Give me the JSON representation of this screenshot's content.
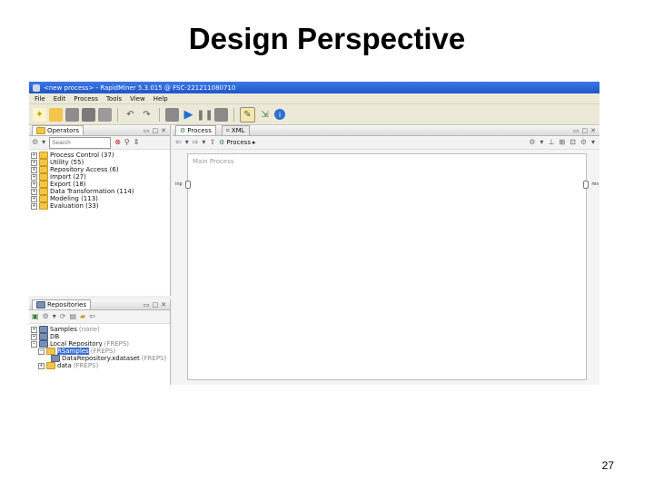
{
  "slide": {
    "title": "Design Perspective",
    "page_number": "27"
  },
  "window": {
    "title": "<new process> - RapidMiner 5.3.015 @ FSC-221211080710"
  },
  "menu": {
    "items": [
      "File",
      "Edit",
      "Process",
      "Tools",
      "View",
      "Help"
    ]
  },
  "toolbar": {
    "icons": [
      "new-process-icon",
      "open-icon",
      "save-icon",
      "save-as-icon",
      "print-icon",
      "undo-icon",
      "redo-icon",
      "import-icon",
      "run-icon",
      "pause-icon",
      "stop-icon",
      "perspective-design-icon",
      "perspective-results-icon",
      "help-icon"
    ]
  },
  "operators_panel": {
    "tab_label": "Operators",
    "search_placeholder": "Search",
    "items": [
      {
        "label": "Process Control (37)"
      },
      {
        "label": "Utility (55)"
      },
      {
        "label": "Repository Access (6)"
      },
      {
        "label": "Import (27)"
      },
      {
        "label": "Export (18)"
      },
      {
        "label": "Data Transformation (114)"
      },
      {
        "label": "Modeling (113)"
      },
      {
        "label": "Evaluation (33)"
      }
    ]
  },
  "repositories_panel": {
    "tab_label": "Repositories",
    "items": [
      {
        "label": "Samples",
        "suffix": "(none)",
        "depth": 0
      },
      {
        "label": "DB",
        "suffix": "",
        "depth": 0
      },
      {
        "label": "Local Repository",
        "suffix": "(FREPS)",
        "depth": 0
      },
      {
        "label": "RSamples",
        "suffix": "(FREPS)",
        "depth": 1,
        "selected": true
      },
      {
        "label": "DataRepository.xdataset",
        "suffix": "(FREPS)",
        "depth": 2
      },
      {
        "label": "data",
        "suffix": "(FREPS)",
        "depth": 1
      }
    ]
  },
  "process_panel": {
    "tabs": [
      {
        "label": "Process"
      },
      {
        "label": "XML"
      }
    ],
    "breadcrumb": "Process",
    "canvas_title": "Main Process",
    "left_port_label": "inp",
    "right_port_label": "res"
  }
}
